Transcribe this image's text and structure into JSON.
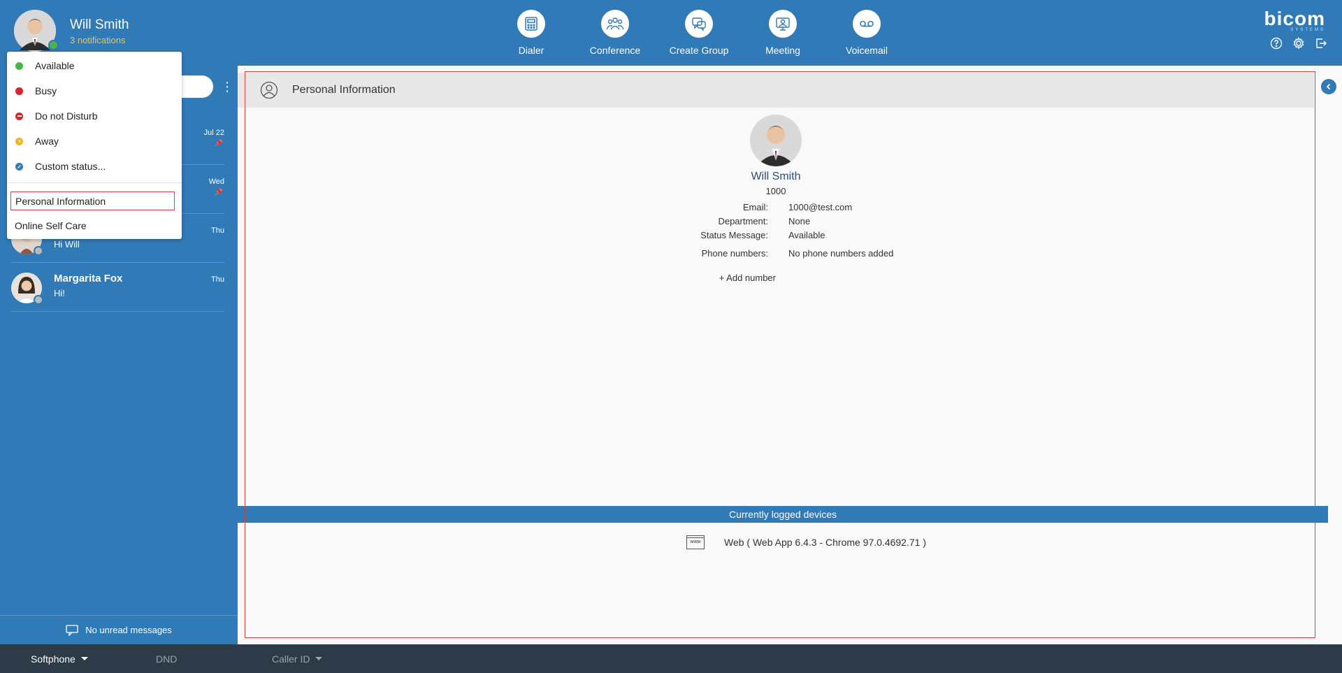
{
  "user": {
    "name": "Will Smith",
    "notifications": "3 notifications",
    "status_color": "#47b74a"
  },
  "nav": [
    {
      "label": "Dialer",
      "icon": "dialer-icon"
    },
    {
      "label": "Conference",
      "icon": "conference-icon"
    },
    {
      "label": "Create Group",
      "icon": "create-group-icon"
    },
    {
      "label": "Meeting",
      "icon": "meeting-icon"
    },
    {
      "label": "Voicemail",
      "icon": "voicemail-icon"
    }
  ],
  "brand": {
    "logo": "bicom",
    "sub": "SYSTEMS"
  },
  "top_icons": [
    "help-icon",
    "settings-icon",
    "logout-icon"
  ],
  "status_menu": {
    "items": [
      {
        "label": "Available",
        "color": "#47b74a"
      },
      {
        "label": "Busy",
        "color": "#d9232f"
      },
      {
        "label": "Do not Disturb",
        "color": "#d9232f"
      },
      {
        "label": "Away",
        "color": "#f0b429"
      },
      {
        "label": "Custom status...",
        "color": "#2f7ab7"
      }
    ],
    "links": [
      "Personal Information",
      "Online Self Care"
    ]
  },
  "conversations": [
    {
      "name": "",
      "message": "",
      "date": "Jul 22",
      "pinned": true
    },
    {
      "name": "",
      "message": "",
      "date": "Wed",
      "pinned": true
    },
    {
      "name": "",
      "message": "Hi Will",
      "date": "Thu",
      "pinned": false
    },
    {
      "name": "Margarita Fox",
      "message": "Hi!",
      "date": "Thu",
      "pinned": false
    }
  ],
  "sidebar_footer": "No unread messages",
  "panel": {
    "title": "Personal Information",
    "profile_name": "Will Smith",
    "extension": "1000",
    "fields": [
      {
        "label": "Email:",
        "value": "1000@test.com"
      },
      {
        "label": "Department:",
        "value": "None"
      },
      {
        "label": "Status Message:",
        "value": "Available"
      },
      {
        "label": "Phone numbers:",
        "value": "No phone numbers added"
      }
    ],
    "add_number": "+ Add number",
    "devices_title": "Currently logged devices",
    "device": "Web ( Web App 6.4.3 - Chrome 97.0.4692.71 )",
    "device_icon_text": "www"
  },
  "bottombar": {
    "softphone": "Softphone",
    "dnd": "DND",
    "caller_id": "Caller ID"
  }
}
